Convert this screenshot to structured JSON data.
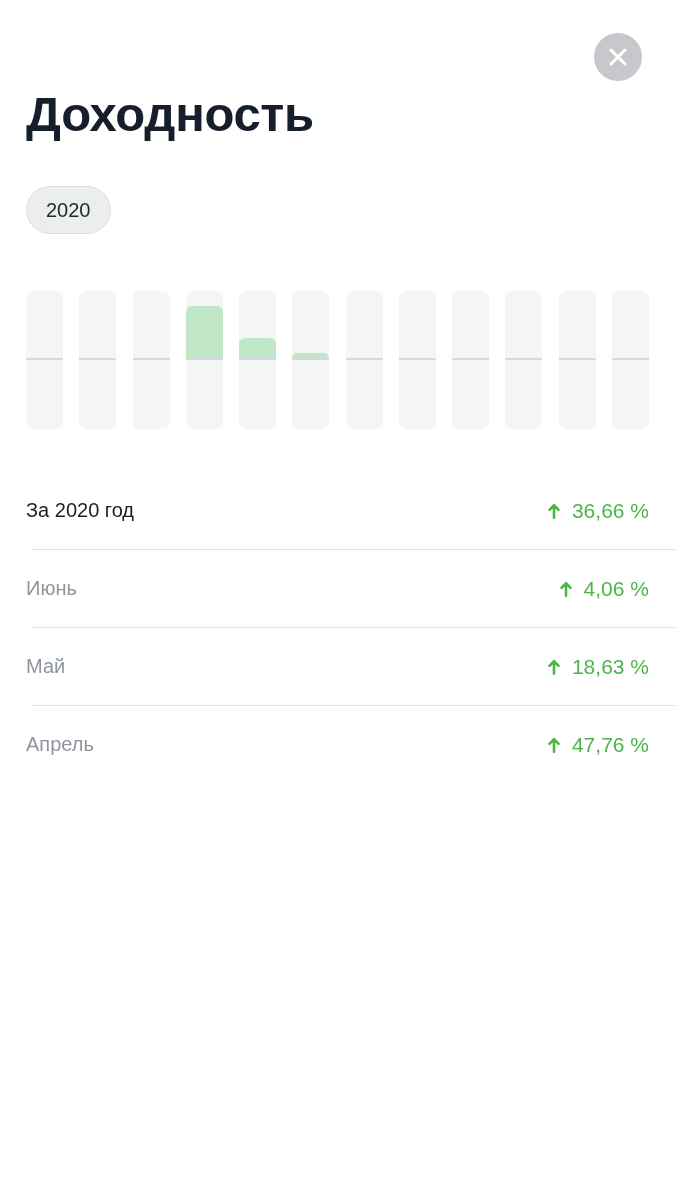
{
  "title": "Доходность",
  "years": [
    {
      "label": "2020",
      "selected": true
    }
  ],
  "rows": [
    {
      "kind": "total",
      "label": "За 2020 год",
      "value": "36,66 %"
    },
    {
      "kind": "month",
      "label": "Июнь",
      "value": "4,06 %"
    },
    {
      "kind": "month",
      "label": "Май",
      "value": "18,63 %"
    },
    {
      "kind": "month",
      "label": "Апрель",
      "value": "47,76 %"
    }
  ]
}
